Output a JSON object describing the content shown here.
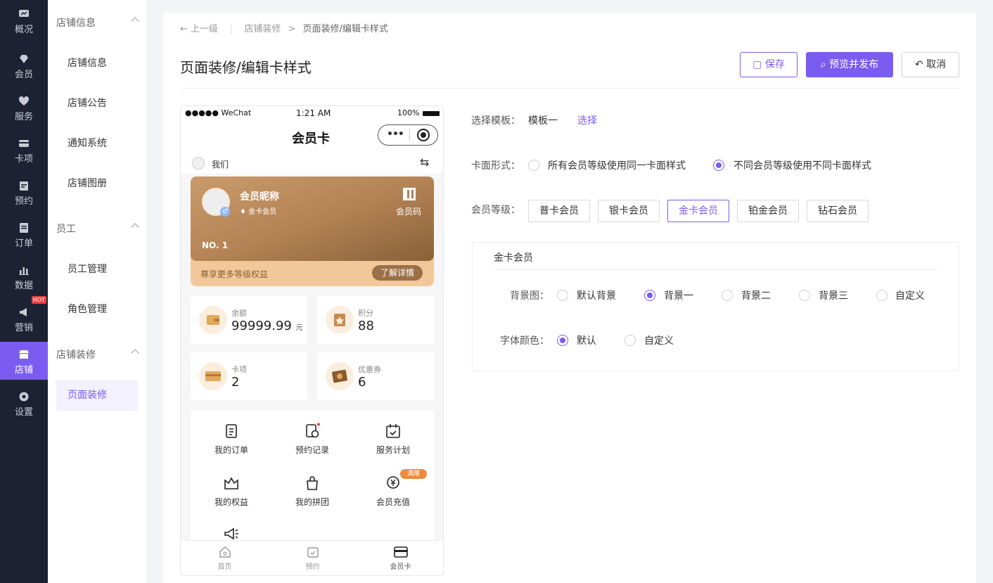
{
  "rail": {
    "items": [
      {
        "label": "概况",
        "icon": "dashboard-icon"
      },
      {
        "label": "会员",
        "icon": "diamond-icon"
      },
      {
        "label": "服务",
        "icon": "service-icon"
      },
      {
        "label": "卡项",
        "icon": "card-icon"
      },
      {
        "label": "预约",
        "icon": "calendar-icon"
      },
      {
        "label": "订单",
        "icon": "order-icon"
      },
      {
        "label": "数据",
        "icon": "chart-icon"
      },
      {
        "label": "营销",
        "icon": "megaphone-icon",
        "badge": "HOT"
      },
      {
        "label": "店铺",
        "icon": "store-icon"
      },
      {
        "label": "设置",
        "icon": "settings-icon"
      }
    ]
  },
  "subnav": {
    "group1": "店铺信息",
    "group1_items": [
      "店铺信息",
      "店铺公告",
      "通知系统",
      "店铺图册"
    ],
    "group2": "员工",
    "group2_items": [
      "员工管理",
      "角色管理"
    ],
    "group3": "店铺装修",
    "group3_items": [
      "页面装修"
    ]
  },
  "breadcrumb": {
    "back": "上一级",
    "parent": "店铺装修",
    "sep": ">",
    "current": "页面装修/编辑卡样式"
  },
  "page_title": "页面装修/编辑卡样式",
  "actions": {
    "save": "保存",
    "preview": "预览并发布",
    "cancel": "取消"
  },
  "phone": {
    "status": {
      "carrier": "●●●●● WeChat",
      "time": "1:21 AM",
      "battery": "100%"
    },
    "title": "会员卡",
    "store": "我们",
    "card": {
      "nickname": "会员昵称",
      "level": "金卡会员",
      "qr_label": "会员码",
      "no": "NO. 1",
      "footer": "尊享更多等级权益",
      "details": "了解详情"
    },
    "stats": [
      {
        "label": "余额",
        "value": "99999.99",
        "unit": "元"
      },
      {
        "label": "积分",
        "value": "88"
      },
      {
        "label": "卡项",
        "value": "2"
      },
      {
        "label": "优惠券",
        "value": "6"
      }
    ],
    "grid": [
      "我的订单",
      "预约记录",
      "服务计划",
      "我的权益",
      "我的拼团",
      "会员充值"
    ],
    "recharge_badge": "满赠",
    "tabs": [
      "首页",
      "预约",
      "会员卡"
    ]
  },
  "form": {
    "template_label": "选择模板：",
    "template_value": "模板一",
    "template_select": "选择",
    "style_label": "卡面形式：",
    "style_options": [
      "所有会员等级使用同一卡面样式",
      "不同会员等级使用不同卡面样式"
    ],
    "level_label": "会员等级：",
    "levels": [
      "普卡会员",
      "银卡会员",
      "金卡会员",
      "铂金会员",
      "钻石会员"
    ],
    "panel_title": "金卡会员",
    "bg_label": "背景图：",
    "bg_options": [
      "默认背景",
      "背景一",
      "背景二",
      "背景三",
      "自定义"
    ],
    "font_label": "字体颜色：",
    "font_options": [
      "默认",
      "自定义"
    ]
  },
  "colors": {
    "accent": "#7b5cf0",
    "rail": "#1c2233",
    "card_gold": "#c99a6a"
  }
}
